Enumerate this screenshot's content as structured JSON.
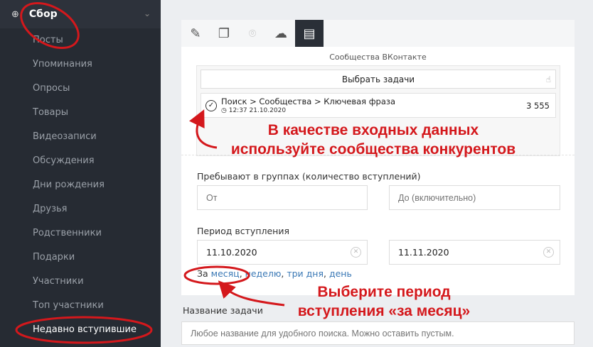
{
  "sidebar": {
    "header": "Сбор",
    "items": [
      "Посты",
      "Упоминания",
      "Опросы",
      "Товары",
      "Видеозаписи",
      "Обсуждения",
      "Дни рождения",
      "Друзья",
      "Родственники",
      "Подарки",
      "Участники",
      "Топ участники",
      "Недавно вступившие"
    ],
    "active_index": 12
  },
  "main": {
    "section_title": "Сообщества ВКонтакте",
    "choose_tasks": "Выбрать задачи",
    "task": {
      "path": "Поиск > Сообщества > Ключевая фраза",
      "time": "12:37 21.10.2020",
      "count": "3 555"
    },
    "groups_label": "Пребывают в группах (количество вступлений)",
    "from_placeholder": "От",
    "to_placeholder": "До (включительно)",
    "period_label": "Период вступления",
    "date_from": "11.10.2020",
    "date_to": "11.11.2020",
    "quick_prefix": "За",
    "quick": [
      "месяц",
      "неделю",
      "три дня",
      "день"
    ],
    "name_label": "Название задачи",
    "name_placeholder": "Любое название для удобного поиска. Можно оставить пустым."
  },
  "annotations": {
    "a1_l1": "В качестве входных данных",
    "a1_l2": "используйте сообщества конкурентов",
    "a2_l1": "Выберите период",
    "a2_l2": "вступления «за месяц»",
    "color": "#d4181c"
  }
}
